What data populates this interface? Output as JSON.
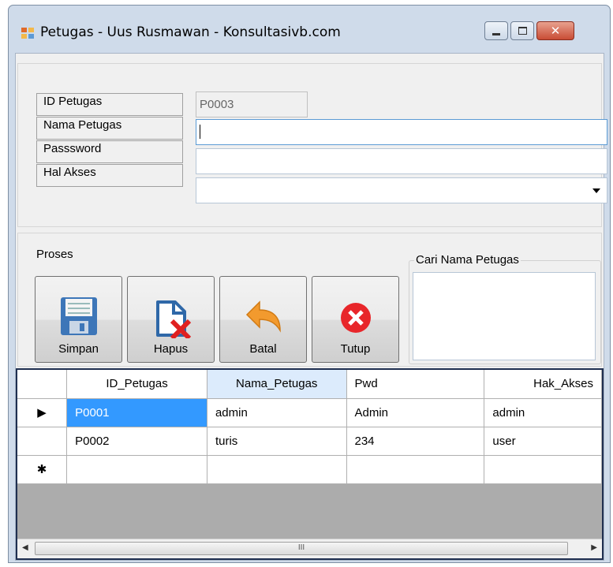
{
  "window": {
    "title": "Petugas - Uus Rusmawan - Konsultasivb.com",
    "buttons": {
      "minimize": "minimize-icon",
      "maximize": "maximize-icon",
      "close": "close-icon"
    }
  },
  "form": {
    "fields": [
      {
        "label": "ID Petugas",
        "value": "P0003",
        "readonly": true
      },
      {
        "label": "Nama Petugas",
        "value": ""
      },
      {
        "label": "Passsword",
        "value": ""
      },
      {
        "label": "Hal Akses",
        "value": "",
        "type": "dropdown"
      }
    ]
  },
  "proses": {
    "title": "Proses",
    "buttons": [
      {
        "label": "Simpan",
        "icon": "floppy-disk-icon"
      },
      {
        "label": "Hapus",
        "icon": "delete-file-icon"
      },
      {
        "label": "Batal",
        "icon": "undo-arrow-icon"
      },
      {
        "label": "Tutup",
        "icon": "close-circle-icon"
      }
    ]
  },
  "search": {
    "title": "Cari Nama Petugas",
    "value": ""
  },
  "grid": {
    "columns": [
      "ID_Petugas",
      "Nama_Petugas",
      "Pwd",
      "Hak_Akses"
    ],
    "rows": [
      {
        "marker": "▶",
        "cells": [
          "P0001",
          "admin",
          "Admin",
          "admin"
        ]
      },
      {
        "marker": "",
        "cells": [
          "P0002",
          "turis",
          "234",
          "user"
        ]
      },
      {
        "marker": "✱",
        "cells": [
          "",
          "",
          "",
          ""
        ]
      }
    ],
    "scroll_thumb": "III"
  },
  "colors": {
    "accent": "#3399ff",
    "close": "#c94c35",
    "frame": "#cfdbea"
  }
}
